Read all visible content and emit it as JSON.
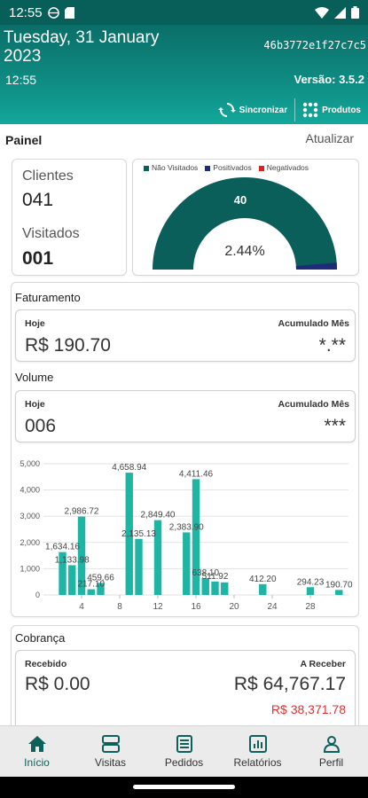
{
  "statusbar": {
    "time": "12:55"
  },
  "header": {
    "date": "Tuesday, 31 January 2023",
    "device_id": "46b3772e1f27c7c5",
    "time": "12:55",
    "version": "Versão: 3.5.2",
    "sync_label": "Sincronizar",
    "products_label": "Produtos"
  },
  "panel": {
    "title": "Painel",
    "refresh_label": "Atualizar",
    "clients_label": "Clientes",
    "clients_value": "041",
    "visited_label": "Visitados",
    "visited_value": "001",
    "gauge": {
      "legend": [
        "Não Visitados",
        "Positivados",
        "Negativados"
      ],
      "legend_colors": [
        "#0b5f5a",
        "#1f2a7a",
        "#e02020"
      ],
      "top_label": "40",
      "center_label": "2.44%",
      "visited_fraction": 0.0244
    }
  },
  "billing": {
    "title": "Faturamento",
    "today_label": "Hoje",
    "today_value": "R$ 190.70",
    "month_label": "Acumulado Mês",
    "month_value": "*.**"
  },
  "volume": {
    "title": "Volume",
    "today_label": "Hoje",
    "today_value": "006",
    "month_label": "Acumulado Mês",
    "month_value": "***"
  },
  "chart_data": {
    "type": "bar",
    "x": [
      2,
      3,
      4,
      5,
      6,
      9,
      10,
      12,
      15,
      16,
      17,
      18,
      19,
      23,
      28,
      31
    ],
    "values": [
      1634.16,
      1133.98,
      2986.72,
      217.1,
      459.66,
      4658.94,
      2135.13,
      2849.4,
      2383.9,
      4411.46,
      638.1,
      511.92,
      480.0,
      412.2,
      294.23,
      190.7
    ],
    "data_labels": [
      "1,634.16",
      "1,133.98",
      "2,986.72",
      "217.10",
      "459.66",
      "4,658.94",
      "2,135.13",
      "2,849.40",
      "2,383.90",
      "4,411.46",
      "638.10",
      "511.92",
      "",
      "412.20",
      "294.23",
      "190.70"
    ],
    "xticks": [
      4,
      8,
      12,
      16,
      20,
      24,
      28
    ],
    "yticks": [
      "0",
      "1,000",
      "2,000",
      "3,000",
      "4,000",
      "5,000"
    ],
    "xlim": [
      0,
      32
    ],
    "ylim": [
      0,
      5000
    ],
    "grid": true,
    "color": "#1fb5a5"
  },
  "collections": {
    "title": "Cobrança",
    "received_label": "Recebido",
    "received_value": "R$ 0.00",
    "receivable_label": "A Receber",
    "receivable_value": "R$ 64,767.17",
    "overdue_value": "R$ 38,371.78",
    "overdue_color": "#e03030"
  },
  "nav": {
    "items": [
      {
        "label": "Início",
        "icon": "home-icon"
      },
      {
        "label": "Visitas",
        "icon": "visits-icon"
      },
      {
        "label": "Pedidos",
        "icon": "orders-icon"
      },
      {
        "label": "Relatórios",
        "icon": "reports-icon"
      },
      {
        "label": "Perfil",
        "icon": "profile-icon"
      }
    ]
  }
}
